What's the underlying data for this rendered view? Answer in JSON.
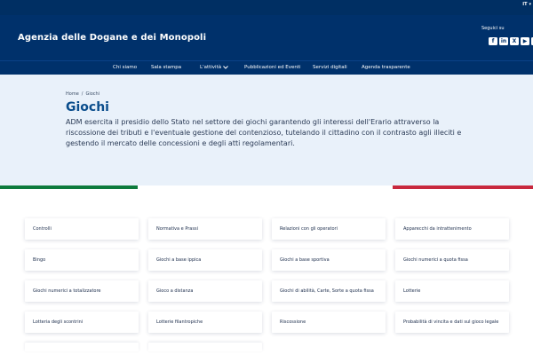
{
  "topbar": {
    "lang": "IT"
  },
  "header": {
    "title": "Agenzia delle Dogane e dei Monopoli",
    "follow_label": "Seguici su",
    "social": [
      "f",
      "in",
      "X",
      "▶",
      "◎"
    ]
  },
  "nav": {
    "items": [
      {
        "label": "Chi siamo",
        "dropdown": false
      },
      {
        "label": "Sala stampa",
        "dropdown": false
      },
      {
        "label": "L'attività",
        "dropdown": true
      },
      {
        "label": "Pubblicazioni ed Eventi",
        "dropdown": false
      },
      {
        "label": "Servizi digitali",
        "dropdown": false
      },
      {
        "label": "Agenda trasparente",
        "dropdown": false
      }
    ]
  },
  "breadcrumb": {
    "home": "Home",
    "separator": "/",
    "current": "Giochi"
  },
  "page": {
    "title": "Giochi",
    "description": "ADM esercita il presidio dello Stato nel settore dei giochi garantendo gli interessi dell'Erario attraverso la riscossione dei tributi e l'eventuale gestione del contenzioso, tutelando il cittadino con il contrasto agli illeciti e gestendo il mercato delle concessioni e degli atti regolamentari."
  },
  "cards": [
    "Controlli",
    "Normativa e Prassi",
    "Relazioni con gli operatori",
    "Apparecchi da intrattenimento",
    "Bingo",
    "Giochi a base ippica",
    "Giochi a base sportiva",
    "Giochi numerici a quota fissa",
    "Giochi numerici a totalizzatore",
    "Gioco a distanza",
    "Giochi di abilità, Carte, Sorte a quota fissa",
    "Lotterie",
    "Lotteria degli scontrini",
    "Lotterie filantropiche",
    "Riscossione",
    "Probabilità di vincita e dati sul gioco legale"
  ],
  "colors": {
    "header": "#00316b",
    "hero": "#e9f1fa",
    "title": "#0a4d8c",
    "flag_green": "#0e7a3c",
    "flag_red": "#c8283e"
  }
}
